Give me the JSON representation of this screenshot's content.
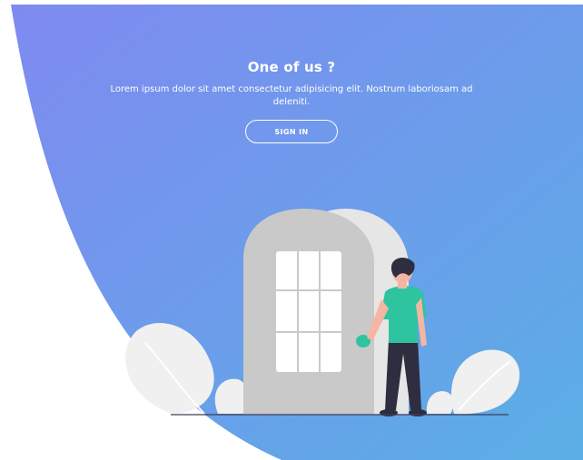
{
  "panel": {
    "title": "One of us ?",
    "text": "Lorem ipsum dolor sit amet consectetur adipisicing elit. Nostrum laboriosam ad deleniti.",
    "button_label": "SIGN IN"
  },
  "colors": {
    "gradient_start": "#7f8df0",
    "gradient_end": "#5aaee6",
    "door": "#c9c9c9",
    "door_wall": "#e6e6e6",
    "window": "#ffffff",
    "shirt": "#2ec4a0",
    "pants": "#2f2e41",
    "skin": "#f5b5a3",
    "hair": "#2f2e41",
    "leaf": "#f0f0f0"
  },
  "icons": {
    "illustration": "person-at-door-illustration"
  }
}
